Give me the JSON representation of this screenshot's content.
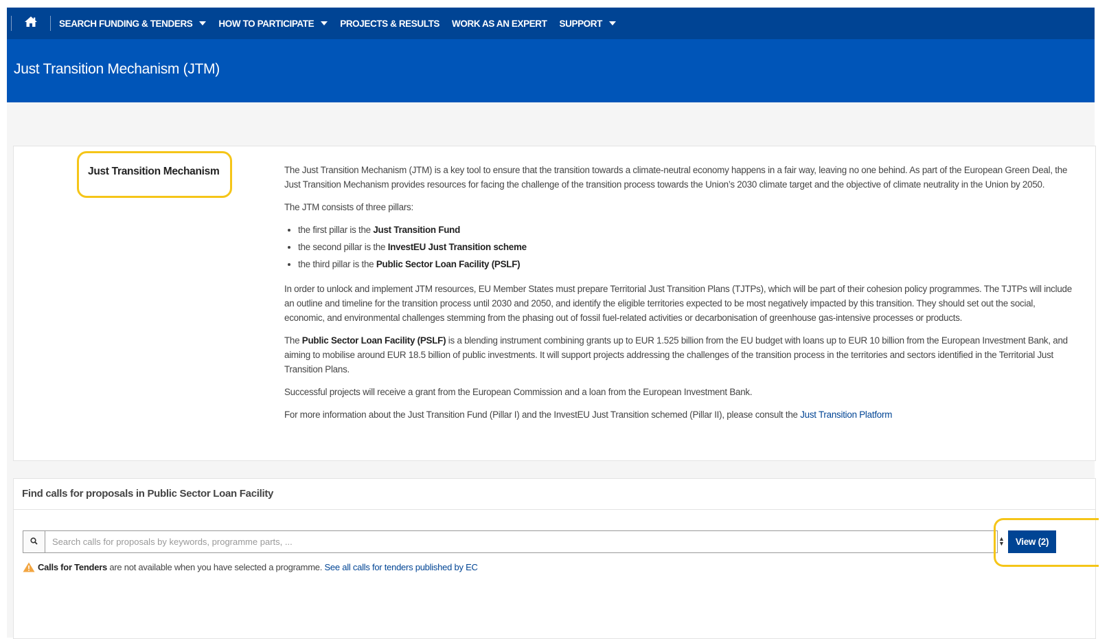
{
  "nav": {
    "items": [
      {
        "label": "SEARCH FUNDING & TENDERS",
        "dropdown": true
      },
      {
        "label": "HOW TO PARTICIPATE",
        "dropdown": true
      },
      {
        "label": "PROJECTS & RESULTS",
        "dropdown": false
      },
      {
        "label": "WORK AS AN EXPERT",
        "dropdown": false
      },
      {
        "label": "SUPPORT",
        "dropdown": true
      }
    ],
    "home_icon": "home-icon"
  },
  "page": {
    "title": "Just Transition Mechanism (JTM)"
  },
  "card": {
    "title": "Just Transition Mechanism",
    "intro": "The Just Transition Mechanism (JTM) is a key tool to ensure that the transition towards a climate-neutral economy happens in a fair way, leaving no one behind. As part of the European Green Deal, the Just Transition Mechanism provides resources for facing the challenge of the transition process towards the Union’s 2030 climate target and the objective of climate neutrality in the Union by 2050.",
    "pillars_intro": "The JTM consists of three pillars:",
    "pillars": [
      {
        "prefix": "the first pillar is the ",
        "bold": "Just Transition Fund"
      },
      {
        "prefix": "the second pillar is the ",
        "bold": "InvestEU Just Transition scheme"
      },
      {
        "prefix": "the third pillar is the ",
        "bold": "Public Sector Loan Facility (PSLF)"
      }
    ],
    "tjtp_paragraph": "In order to unlock and implement JTM resources, EU Member States must prepare Territorial Just Transition Plans (TJTPs), which will be part of their cohesion policy programmes. The TJTPs will include an outline and timeline for the transition process until 2030 and 2050, and identify the eligible territories expected to be most negatively impacted by this transition. They should set out the social, economic, and environmental challenges stemming from the phasing out of fossil fuel-related activities or decarbonisation of greenhouse gas-intensive processes or products.",
    "pslf_prefix": "The ",
    "pslf_bold": "Public Sector Loan Facility (PSLF)",
    "pslf_rest": " is a blending instrument combining grants up to EUR 1.525 billion from the EU budget with loans up to EUR 10 billion from the European Investment Bank, and aiming to mobilise around EUR 18.5 billion of public investments. It will support projects addressing the challenges of the transition process in the territories and sectors identified in the Territorial Just Transition Plans.",
    "success": "Successful projects will receive a grant from the European Commission and a loan from the European Investment Bank.",
    "more_info_prefix": "For more information about the Just Transition Fund (Pillar I) and the InvestEU Just Transition schemed (Pillar II), please consult the ",
    "more_info_link": "Just Transition Platform"
  },
  "search_panel": {
    "heading": "Find calls for proposals in Public Sector Loan Facility",
    "placeholder": "Search calls for proposals by keywords, programme parts, ...",
    "value": "",
    "view_button": "View (2)",
    "notice_bold": "Calls for Tenders",
    "notice_text": " are not available when you have selected a programme. ",
    "notice_link": "See all calls for tenders published by EC"
  },
  "colors": {
    "nav_bg": "#004494",
    "title_bg": "#0055b8",
    "highlight": "#f5c518",
    "link": "#004494",
    "warning": "#f2a541"
  }
}
